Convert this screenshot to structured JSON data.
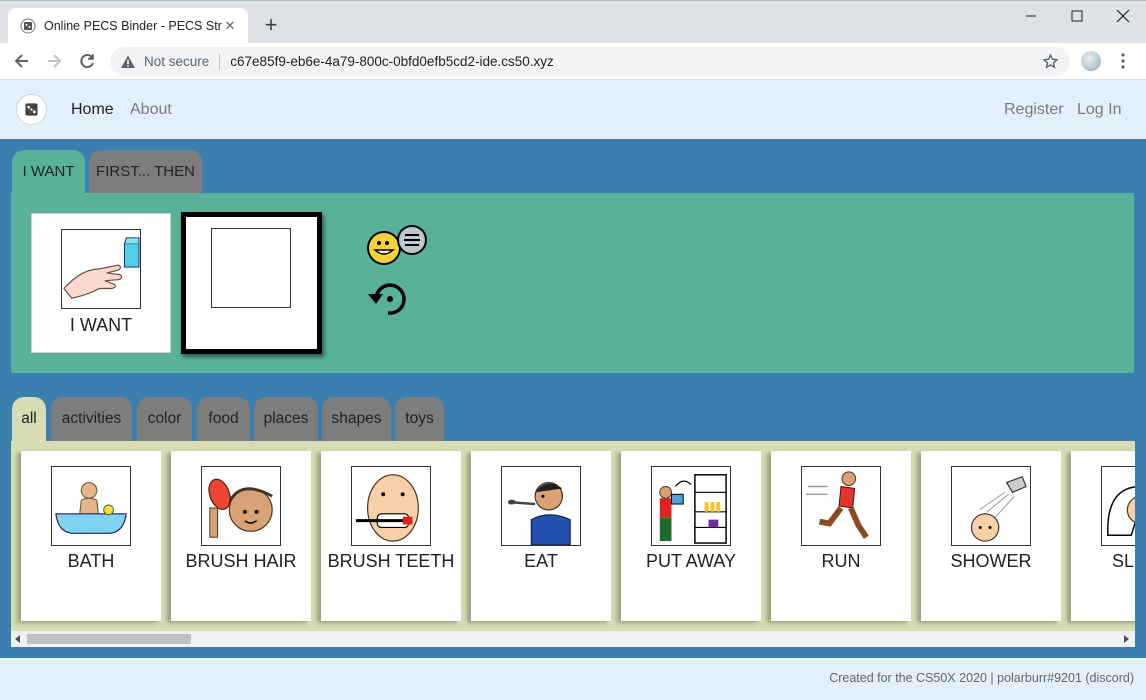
{
  "browser": {
    "tab_title": "Online PECS Binder - PECS Strip",
    "tab_close": "✕",
    "new_tab": "+",
    "security_status": "Not secure",
    "url": "c67e85f9-eb6e-4a79-800c-0bfd0efb5cd2-ide.cs50.xyz"
  },
  "nav": {
    "home": "Home",
    "about": "About",
    "register": "Register",
    "login": "Log In"
  },
  "strip": {
    "tabs": [
      {
        "label": "I WANT",
        "active": true
      },
      {
        "label": "FIRST... THEN",
        "active": false
      }
    ],
    "cards": [
      {
        "label": "I WANT",
        "icon": "hand-reaching-cup-icon"
      },
      {
        "label": "",
        "icon": "empty-slot"
      }
    ],
    "actions": [
      {
        "icon": "speak-icon"
      },
      {
        "icon": "reset-icon"
      }
    ]
  },
  "categories": [
    {
      "label": "all",
      "active": true
    },
    {
      "label": "activities",
      "active": false
    },
    {
      "label": "color",
      "active": false
    },
    {
      "label": "food",
      "active": false
    },
    {
      "label": "places",
      "active": false
    },
    {
      "label": "shapes",
      "active": false
    },
    {
      "label": "toys",
      "active": false
    }
  ],
  "activity_cards": [
    {
      "label": "BATH",
      "icon": "bath-icon"
    },
    {
      "label": "BRUSH HAIR",
      "icon": "brush-hair-icon"
    },
    {
      "label": "BRUSH TEETH",
      "icon": "brush-teeth-icon"
    },
    {
      "label": "EAT",
      "icon": "eat-icon"
    },
    {
      "label": "PUT AWAY",
      "icon": "put-away-icon"
    },
    {
      "label": "RUN",
      "icon": "run-icon"
    },
    {
      "label": "SHOWER",
      "icon": "shower-icon"
    },
    {
      "label": "SLEEP",
      "icon": "sleep-icon"
    }
  ],
  "footer": {
    "text": "Created for the CS50X 2020 | polarburr#9201 (discord)"
  },
  "colors": {
    "page_bg": "#3a7fb0",
    "navbar_bg": "#e3f0fb",
    "strip_green": "#58b29a",
    "cards_panel": "#d7dcb4",
    "tab_inactive": "#7d7d7d"
  }
}
